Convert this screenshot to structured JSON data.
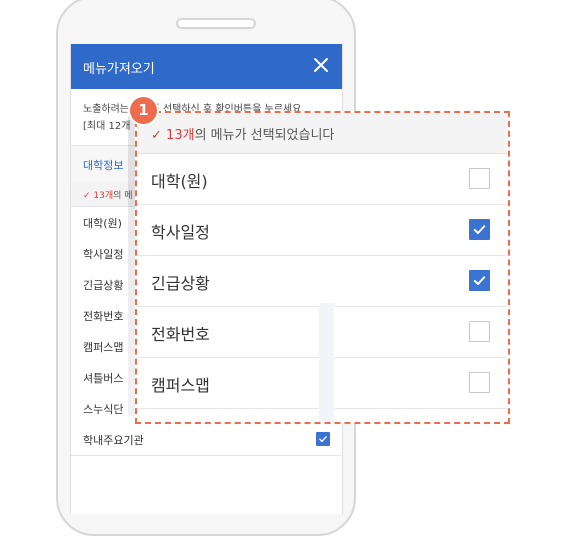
{
  "header": {
    "title": "메뉴가져오기",
    "close_icon": "close-icon"
  },
  "notice": {
    "line1": "노출하려는 메뉴를 선택하신 후 확인버튼을 누르세요.",
    "line2": "[최대 12개"
  },
  "section": {
    "title": "대학정보"
  },
  "selection": {
    "count": "13개",
    "suffix_small": "의 메",
    "suffix": "의 메뉴가 선택되었습니다"
  },
  "menu_items": [
    {
      "label": "대학(원)",
      "checked": false
    },
    {
      "label": "학사일정",
      "checked": true
    },
    {
      "label": "긴급상황",
      "checked": true
    },
    {
      "label": "전화번호",
      "checked": false
    },
    {
      "label": "캠퍼스맵",
      "checked": false
    },
    {
      "label": "셔틀버스",
      "checked": false
    },
    {
      "label": "스누식단",
      "checked": true
    },
    {
      "label": "학내주요기관",
      "checked": true
    }
  ],
  "callout": {
    "badge": "1",
    "items": [
      {
        "label": "대학(원)",
        "checked": false
      },
      {
        "label": "학사일정",
        "checked": true
      },
      {
        "label": "긴급상황",
        "checked": true
      },
      {
        "label": "전화번호",
        "checked": false
      },
      {
        "label": "캠퍼스맵",
        "checked": false
      }
    ]
  },
  "colors": {
    "primary": "#2f69c9",
    "accent": "#ee6b4e",
    "check": "#3b73d3",
    "red": "#e53935"
  }
}
